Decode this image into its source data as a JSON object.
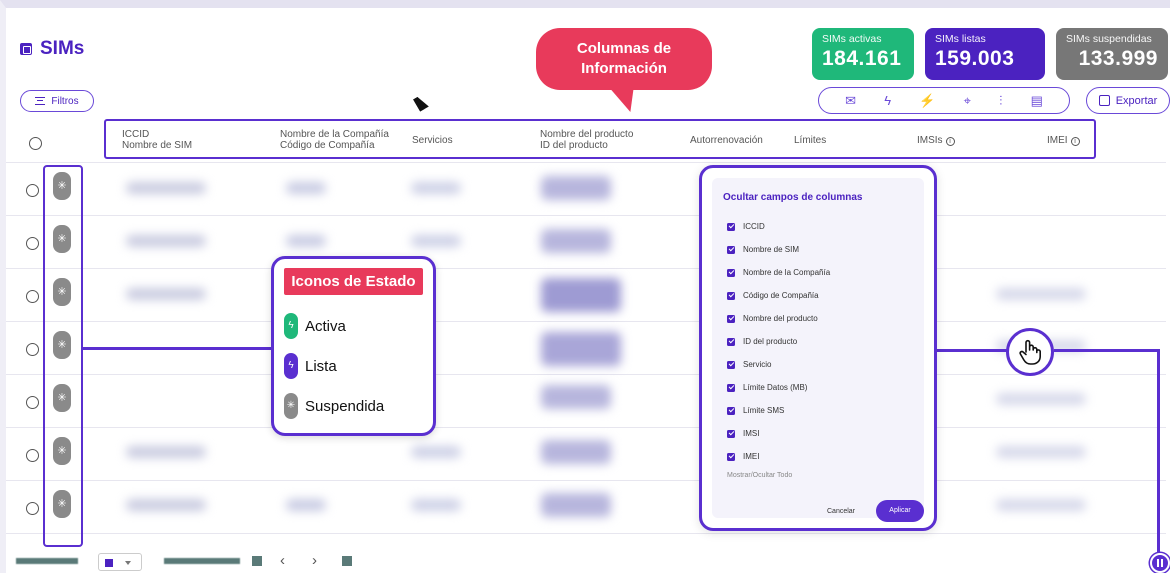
{
  "header": {
    "title": "SIMs",
    "callout": "Columnas de Información"
  },
  "stats": [
    {
      "label": "SIMs activas",
      "value": "184.161",
      "color": "#1fb87a"
    },
    {
      "label": "SIMs listas",
      "value": "159.003",
      "color": "#4b22c0"
    },
    {
      "label": "SIMs suspendidas",
      "value": "133.999",
      "color": "#777777"
    }
  ],
  "toolbar": {
    "filters_label": "Filtros",
    "export_label": "Exportar",
    "actions": [
      "mail-icon",
      "bolt-icon",
      "bolt-off-icon",
      "location-icon",
      "equalizer-icon",
      "sim-settings-icon"
    ]
  },
  "columns": {
    "iccid": "ICCID",
    "sim_name": "Nombre de SIM",
    "company_name": "Nombre de la Compañía",
    "company_code": "Código de Compañía",
    "services": "Servicios",
    "product_name": "Nombre del producto",
    "product_id": "ID del producto",
    "autorenew": "Autorrenovación",
    "limits": "Límites",
    "imsis": "IMSIs",
    "imei": "IMEI"
  },
  "legend": {
    "title": "Iconos de Estado",
    "items": [
      {
        "label": "Activa",
        "color": "#1fb87a"
      },
      {
        "label": "Lista",
        "color": "#5a2fd0"
      },
      {
        "label": "Suspendida",
        "color": "#8a8a8a"
      }
    ]
  },
  "column_panel": {
    "title": "Ocultar campos de columnas",
    "items": [
      "ICCID",
      "Nombre de SIM",
      "Nombre de la Compañía",
      "Código de Compañía",
      "Nombre del producto",
      "ID del producto",
      "Servicio",
      "Límite Datos (MB)",
      "Límite SMS",
      "IMSI",
      "IMEI"
    ],
    "toggle_all": "Mostrar/Ocultar Todo",
    "cancel": "Cancelar",
    "apply": "Aplicar"
  },
  "colors": {
    "primary": "#4b22c0",
    "accent": "#e83a5b",
    "active": "#1fb87a",
    "suspended": "#777777"
  }
}
